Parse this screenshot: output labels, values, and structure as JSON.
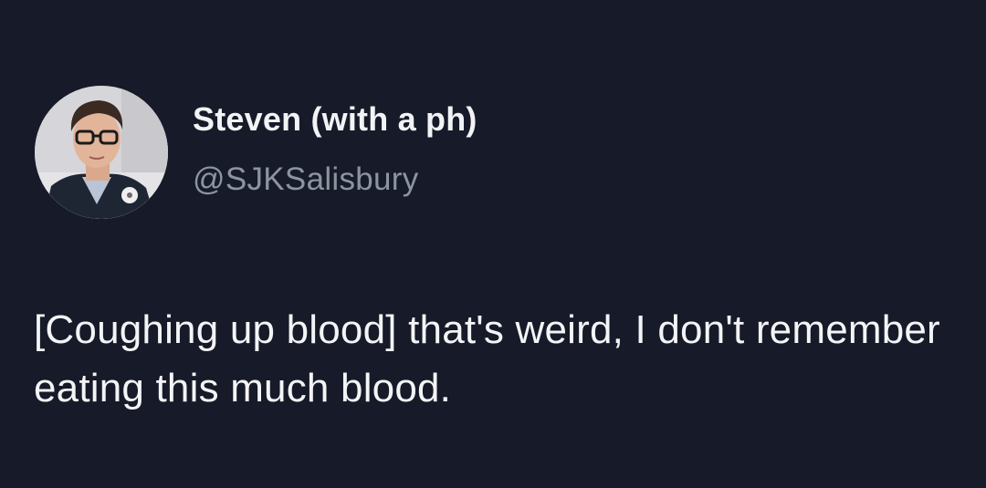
{
  "tweet": {
    "author": {
      "display_name": "Steven (with a ph)",
      "handle": "@SJKSalisbury",
      "avatar_icon": "profile-photo"
    },
    "text": "[Coughing up blood] that's weird, I don't remember eating this much blood."
  },
  "colors": {
    "background": "#171a28",
    "name_text": "#f2f3f5",
    "handle_text": "#8b95a0",
    "body_text": "#f3f4f6"
  }
}
